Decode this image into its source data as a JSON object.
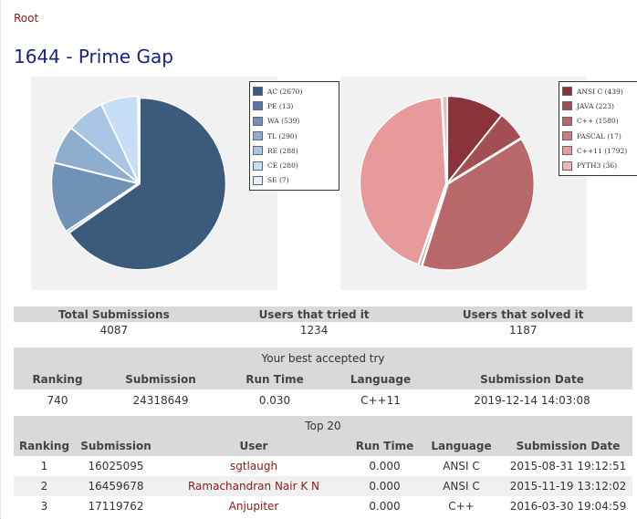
{
  "breadcrumb": {
    "root": "Root"
  },
  "problem": {
    "title": "1644 - Prime Gap"
  },
  "verdict_chart": {
    "chart_data": {
      "type": "pie",
      "slices": [
        {
          "label": "AC (2670)",
          "value": 2670,
          "color": "#3b5a7c"
        },
        {
          "label": "PE (13)",
          "value": 13,
          "color": "#5577a0"
        },
        {
          "label": "WA (539)",
          "value": 539,
          "color": "#7092b7"
        },
        {
          "label": "TL (290)",
          "value": 290,
          "color": "#8eaed0"
        },
        {
          "label": "RE (288)",
          "value": 288,
          "color": "#a9c6e4"
        },
        {
          "label": "CE (280)",
          "value": 280,
          "color": "#c6dff7"
        },
        {
          "label": "SE (7)",
          "value": 7,
          "color": "#e3f0fc"
        }
      ]
    }
  },
  "language_chart": {
    "chart_data": {
      "type": "pie",
      "slices": [
        {
          "label": "ANSI C (439)",
          "value": 439,
          "color": "#8a3338"
        },
        {
          "label": "JAVA (223)",
          "value": 223,
          "color": "#a24e52"
        },
        {
          "label": "C++ (1580)",
          "value": 1580,
          "color": "#b8676a"
        },
        {
          "label": "PASCAL (17)",
          "value": 17,
          "color": "#cc7e80"
        },
        {
          "label": "C++11 (1792)",
          "value": 1792,
          "color": "#e89a9b"
        },
        {
          "label": "PYTH3 (36)",
          "value": 36,
          "color": "#f6b6b6"
        }
      ]
    }
  },
  "stats": {
    "headers": [
      "Total Submissions",
      "Users that tried it",
      "Users that solved it"
    ],
    "values": [
      "4087",
      "1234",
      "1187"
    ]
  },
  "best_try": {
    "caption": "Your best accepted try",
    "headers": [
      "Ranking",
      "Submission",
      "Run Time",
      "Language",
      "Submission Date"
    ],
    "row": [
      "740",
      "24318649",
      "0.030",
      "C++11",
      "2019-12-14 14:03:08"
    ]
  },
  "top20": {
    "caption": "Top 20",
    "headers": [
      "Ranking",
      "Submission",
      "User",
      "Run Time",
      "Language",
      "Submission Date"
    ],
    "rows": [
      [
        "1",
        "16025095",
        "sgtlaugh",
        "0.000",
        "ANSI C",
        "2015-08-31 19:12:51"
      ],
      [
        "2",
        "16459678",
        "Ramachandran Nair K N",
        "0.000",
        "ANSI C",
        "2015-11-19 13:12:02"
      ],
      [
        "3",
        "17119762",
        "Anjupiter",
        "0.000",
        "C++",
        "2016-03-30 19:04:59"
      ]
    ]
  }
}
